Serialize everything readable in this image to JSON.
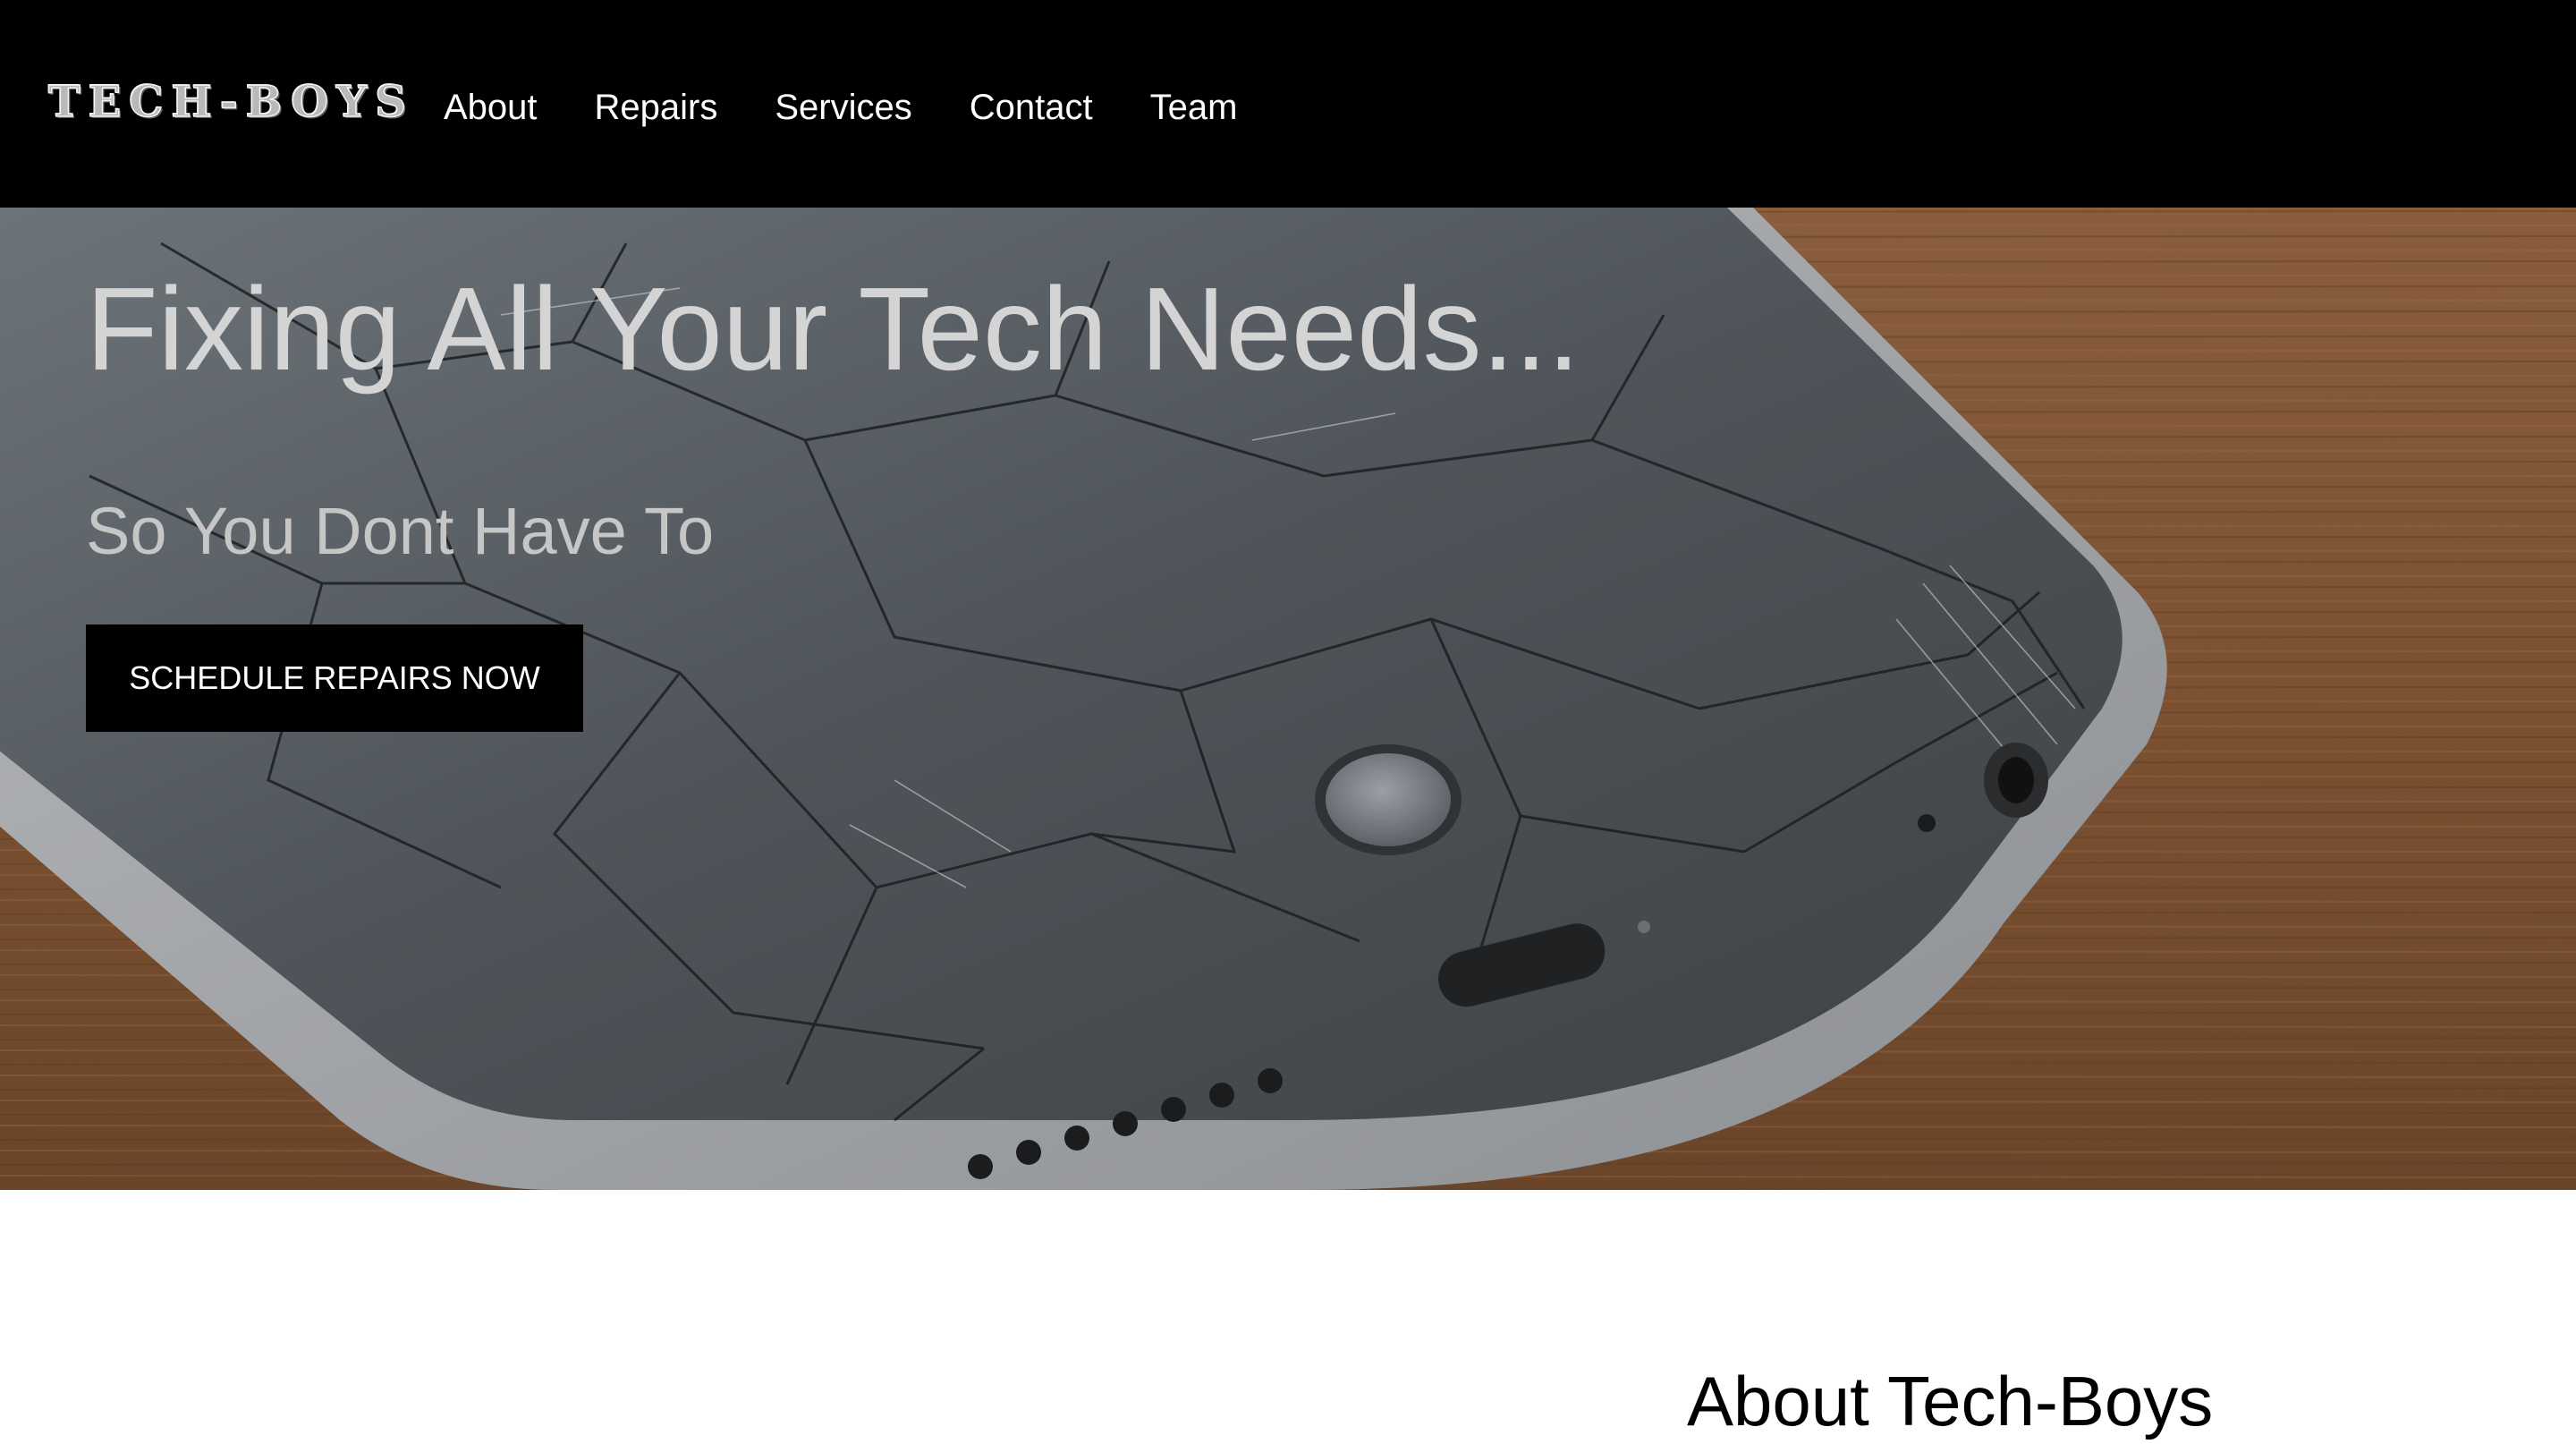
{
  "header": {
    "logo_text": "TECH-BOYS",
    "nav": [
      {
        "label": "About"
      },
      {
        "label": "Repairs"
      },
      {
        "label": "Services"
      },
      {
        "label": "Contact"
      },
      {
        "label": "Team"
      }
    ]
  },
  "hero": {
    "title": "Fixing All Your Tech Needs...",
    "subtitle": "So You Dont Have To",
    "cta_label": "SCHEDULE REPAIRS NOW",
    "background_image": "cracked-smartphone-on-wooden-table"
  },
  "about": {
    "heading": "About Tech-Boys"
  },
  "colors": {
    "navbar_bg": "#000000",
    "nav_text": "#ffffff",
    "hero_title": "#d4d4d4",
    "cta_bg": "#000000",
    "cta_text": "#ffffff",
    "page_bg": "#ffffff"
  }
}
